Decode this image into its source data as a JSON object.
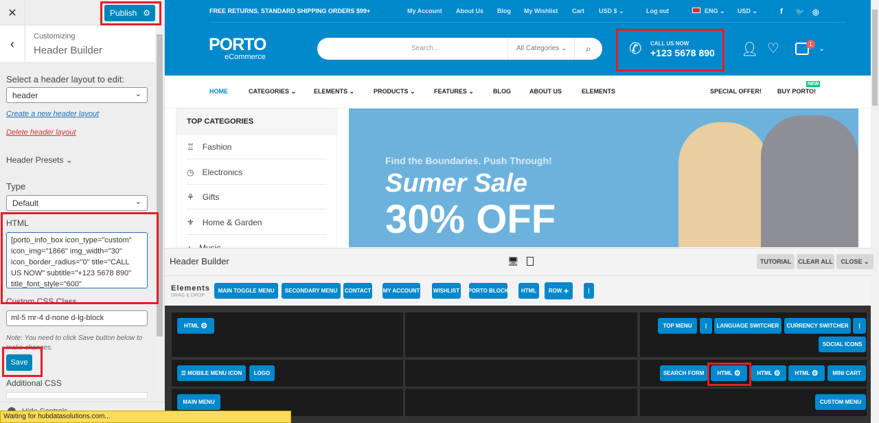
{
  "customizer": {
    "close_icon": "close-icon",
    "publish_label": "Publish",
    "gear_icon": "gear-icon",
    "breadcrumb": "Customizing",
    "title": "Header Builder",
    "layout_label": "Select a header layout to edit:",
    "layout_value": "header",
    "create_link": "Create a new header layout",
    "delete_link": "Delete header layout",
    "presets_label": "Header Presets",
    "type_label": "Type",
    "type_value": "Default",
    "html_label": "HTML",
    "html_value": "[porto_info_box icon_type=\"custom\" icon_img=\"1866\" img_width=\"30\" icon_border_radius=\"0\" title=\"CALL US NOW\" subtitle=\"+123 5678 890\" title_font_style=\"600\"",
    "css_class_label": "Custom CSS Class",
    "css_class_value": "ml-5 mr-4 d-none d-lg-block",
    "note": "Note: You need to click Save button below to make changes.",
    "save_label": "Save",
    "additional_css_label": "Additional CSS",
    "hide_controls": "Hide Controls"
  },
  "status_bar": "Waiting for hubdatasolutions.com...",
  "site": {
    "topbar_text": "FREE RETURNS. STANDARD SHIPPING ORDERS $99+",
    "top_links": [
      "My Account",
      "About Us",
      "Blog",
      "My Wishlist",
      "Cart",
      "USD $",
      "Log out",
      "ENG",
      "USD"
    ],
    "logo": "PORTO",
    "logo_sub": "eCommerce",
    "search_placeholder": "Search...",
    "search_category": "All Categories",
    "call_title": "CALL US NOW",
    "call_number": "+123 5678 890",
    "cart_count": "1",
    "nav": [
      "HOME",
      "CATEGORIES",
      "ELEMENTS",
      "PRODUCTS",
      "FEATURES",
      "BLOG",
      "ABOUT US",
      "ELEMENTS"
    ],
    "special_offer": "SPECIAL OFFER!",
    "buy_porto": "BUY PORTO!",
    "new_badge": "NEW",
    "top_categories": "TOP CATEGORIES",
    "categories": [
      "Fashion",
      "Electronics",
      "Gifts",
      "Home & Garden",
      "Music"
    ],
    "banner_tagline": "Find the Boundaries. Push Through!",
    "banner_title": "Sumer Sale",
    "banner_offer": "30% OFF",
    "brand_color": "#0088cc"
  },
  "builder": {
    "title": "Header Builder",
    "tutorial": "TUTORIAL",
    "clear_all": "CLEAR ALL",
    "close": "CLOSE",
    "elements_label": "Elements",
    "elements_sub": "DRAG & DROP",
    "elements": [
      "MAIN TOGGLE MENU",
      "SECONDARY MENU",
      "CONTACT",
      "MY ACCOUNT",
      "WISHLIST",
      "PORTO BLOCK",
      "HTML",
      "ROW",
      "|"
    ],
    "row1_left": [
      "HTML"
    ],
    "row1_right": [
      "TOP MENU",
      "|",
      "LANGUAGE SWITCHER",
      "CURRENCY SWITCHER",
      "|",
      "SOCIAL ICONS"
    ],
    "row2_left": [
      "MOBILE MENU ICON",
      "LOGO"
    ],
    "row2_right": [
      "SEARCH FORM",
      "HTML",
      "HTML",
      "HTML",
      "MINI CART"
    ],
    "row3_left": [
      "MAIN MENU"
    ],
    "row3_right": [
      "CUSTOM MENU"
    ]
  }
}
